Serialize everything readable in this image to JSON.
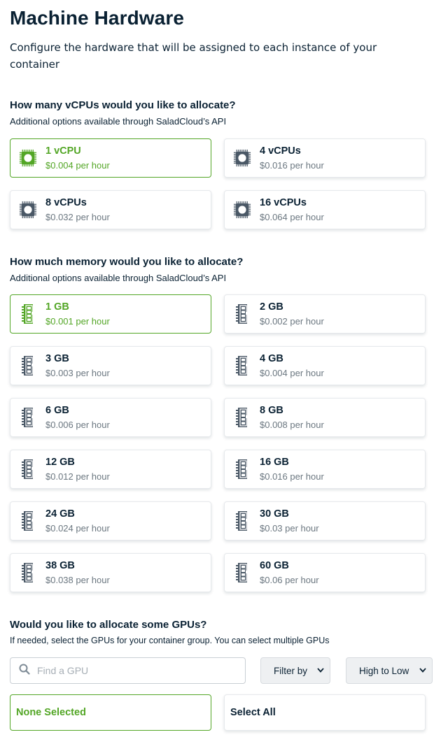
{
  "header": {
    "title": "Machine Hardware",
    "description": "Configure the hardware that will be assigned to each instance of your container"
  },
  "cpu": {
    "title": "How many vCPUs would you like to allocate?",
    "subtitle": "Additional options available through SaladCloud’s API",
    "icon": "cpu-chip-icon",
    "options": [
      {
        "label": "1 vCPU",
        "price": "$0.004 per hour",
        "selected": true
      },
      {
        "label": "4 vCPUs",
        "price": "$0.016 per hour",
        "selected": false
      },
      {
        "label": "8 vCPUs",
        "price": "$0.032 per hour",
        "selected": false
      },
      {
        "label": "16 vCPUs",
        "price": "$0.064 per hour",
        "selected": false
      }
    ]
  },
  "memory": {
    "title": "How much memory would you like to allocate?",
    "subtitle": "Additional options available through SaladCloud’s API",
    "icon": "memory-stick-icon",
    "options": [
      {
        "label": "1 GB",
        "price": "$0.001 per hour",
        "selected": true
      },
      {
        "label": "2 GB",
        "price": "$0.002 per hour",
        "selected": false
      },
      {
        "label": "3 GB",
        "price": "$0.003 per hour",
        "selected": false
      },
      {
        "label": "4 GB",
        "price": "$0.004 per hour",
        "selected": false
      },
      {
        "label": "6 GB",
        "price": "$0.006 per hour",
        "selected": false
      },
      {
        "label": "8 GB",
        "price": "$0.008 per hour",
        "selected": false
      },
      {
        "label": "12 GB",
        "price": "$0.012 per hour",
        "selected": false
      },
      {
        "label": "16 GB",
        "price": "$0.016 per hour",
        "selected": false
      },
      {
        "label": "24 GB",
        "price": "$0.024 per hour",
        "selected": false
      },
      {
        "label": "30 GB",
        "price": "$0.03 per hour",
        "selected": false
      },
      {
        "label": "38 GB",
        "price": "$0.038 per hour",
        "selected": false
      },
      {
        "label": "60 GB",
        "price": "$0.06 per hour",
        "selected": false
      }
    ]
  },
  "gpu": {
    "title": "Would you like to allocate some GPUs?",
    "subtitle": "If needed, select the GPUs for your container group. You can select multiple GPUs",
    "search_placeholder": "Find a GPU",
    "filter_label": "Filter by",
    "sort_label": "High to Low",
    "none_label": "None Selected",
    "all_label": "Select All"
  },
  "colors": {
    "accent": "#53a626",
    "text": "#0a2133",
    "muted": "#6b7780",
    "icon": "#4a5866"
  }
}
